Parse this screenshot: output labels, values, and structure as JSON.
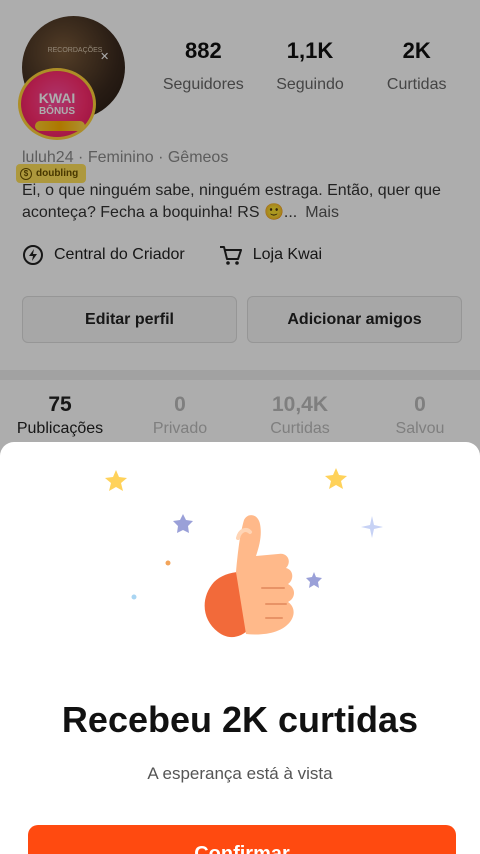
{
  "profile": {
    "avatar_caption": "RECORDAÇÕES",
    "bonus_badge": {
      "line1": "KWAI",
      "line2": "BÔNUS"
    },
    "status_badge": "doubling",
    "stats": [
      {
        "value": "882",
        "label": "Seguidores"
      },
      {
        "value": "1,1K",
        "label": "Seguindo"
      },
      {
        "value": "2K",
        "label": "Curtidas"
      }
    ],
    "info_line": "luluh24 · Feminino · Gêmeos",
    "bio": "Ei, o que ninguém sabe, ninguém estraga. Então, quer que aconteça? Fecha a boquinha! RS 🙂...",
    "bio_more": "Mais",
    "links": [
      {
        "label": "Central do Criador",
        "icon": "lightning-icon"
      },
      {
        "label": "Loja Kwai",
        "icon": "cart-icon"
      }
    ],
    "buttons": {
      "edit": "Editar perfil",
      "add_friends": "Adicionar amigos"
    },
    "tabs": [
      {
        "value": "75",
        "label": "Publicações",
        "active": true
      },
      {
        "value": "0",
        "label": "Privado",
        "active": false
      },
      {
        "value": "10,4K",
        "label": "Curtidas",
        "active": false
      },
      {
        "value": "0",
        "label": "Salvou",
        "active": false
      }
    ]
  },
  "sheet": {
    "illustration": "thumbs-up-icon",
    "title": "Recebeu 2K curtidas",
    "subtitle": "A esperança está à vista",
    "confirm_label": "Confirmar"
  },
  "colors": {
    "accent": "#ff4a10",
    "bonus_pink": "#ff2d6f",
    "badge_yellow": "#ffe15a"
  }
}
